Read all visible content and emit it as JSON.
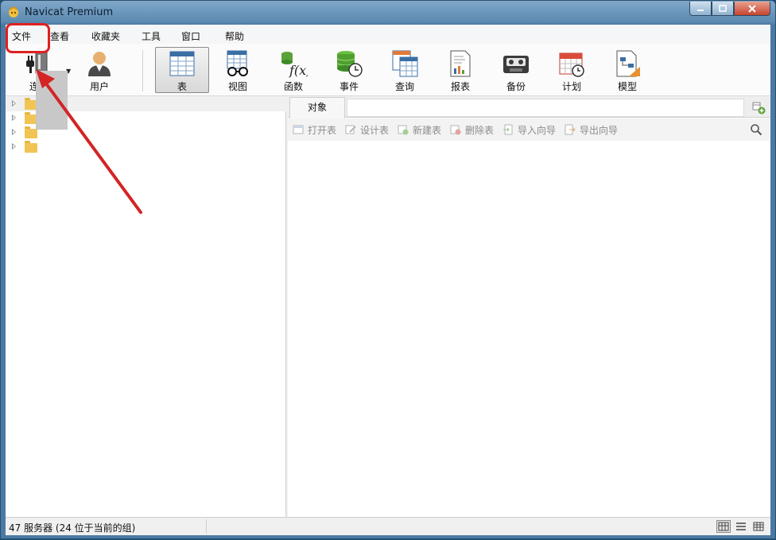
{
  "window": {
    "title": "Navicat Premium"
  },
  "menu": {
    "items": [
      "文件",
      "查看",
      "收藏夹",
      "工具",
      "窗口",
      "帮助"
    ]
  },
  "toolbar": {
    "items": [
      {
        "label": "连接",
        "icon": "connection-plug-icon"
      },
      {
        "label": "用户",
        "icon": "user-icon"
      },
      {
        "label": "表",
        "icon": "table-icon",
        "active": true
      },
      {
        "label": "视图",
        "icon": "view-glasses-icon"
      },
      {
        "label": "函数",
        "icon": "function-icon"
      },
      {
        "label": "事件",
        "icon": "event-icon"
      },
      {
        "label": "查询",
        "icon": "query-icon"
      },
      {
        "label": "报表",
        "icon": "report-icon"
      },
      {
        "label": "备份",
        "icon": "backup-tape-icon"
      },
      {
        "label": "计划",
        "icon": "schedule-calendar-icon"
      },
      {
        "label": "模型",
        "icon": "model-icon"
      }
    ]
  },
  "tree": {
    "group_count_visible": 4
  },
  "objects": {
    "tab_label": "对象",
    "actions": [
      "打开表",
      "设计表",
      "新建表",
      "删除表",
      "导入向导",
      "导出向导"
    ]
  },
  "status": {
    "text": "47 服务器 (24 位于当前的组)"
  },
  "colors": {
    "annotation": "#e02020",
    "folder": "#f1c453",
    "titlebar": "#5d8ab1"
  }
}
